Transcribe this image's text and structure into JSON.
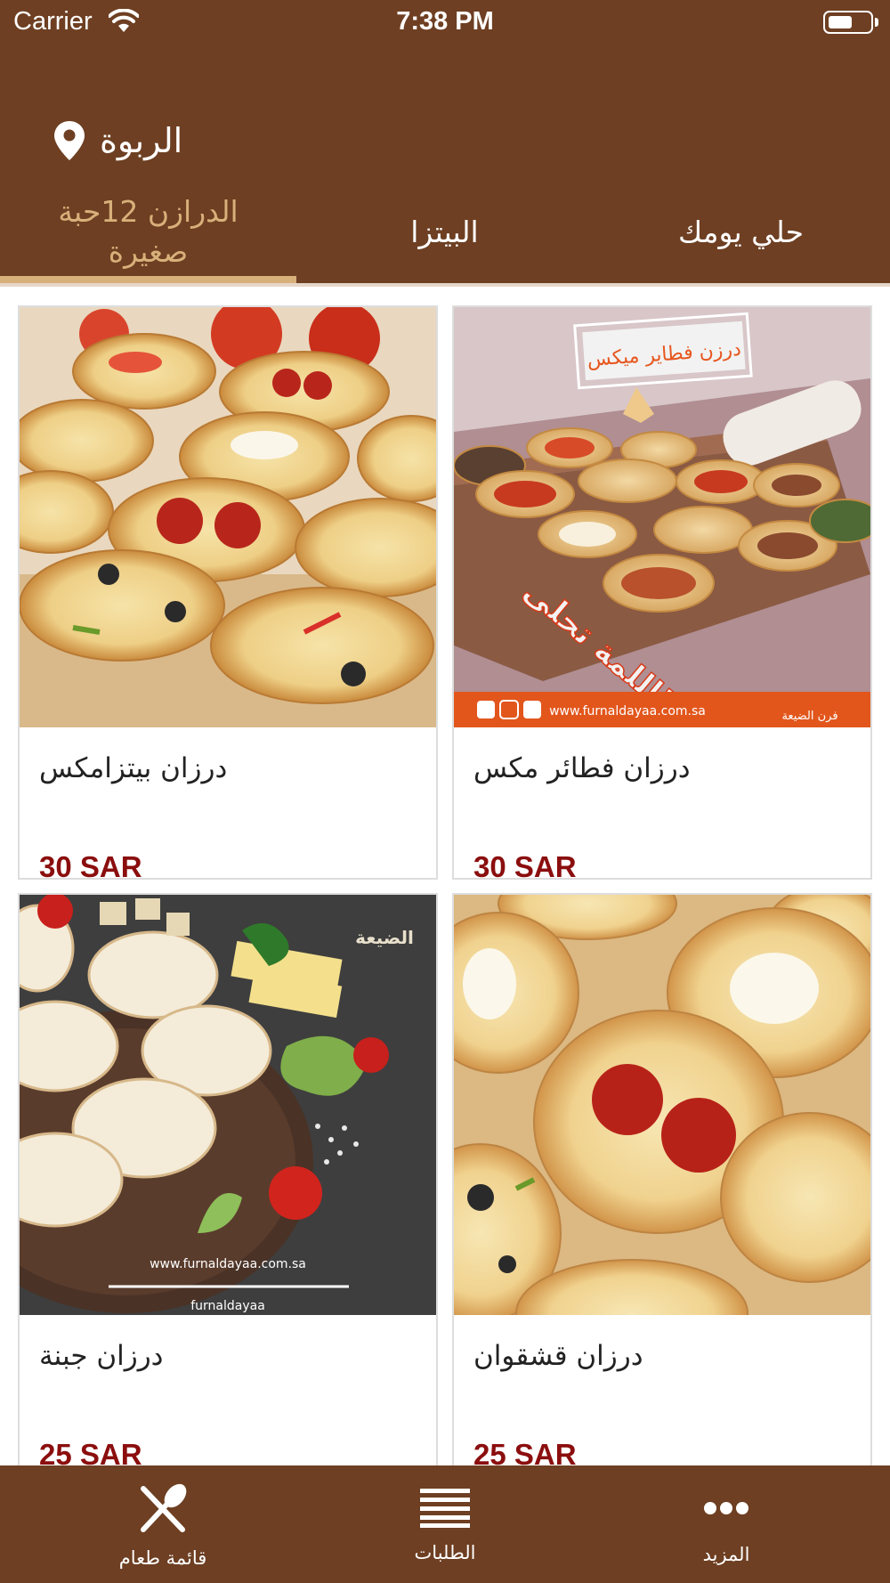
{
  "status_bar": {
    "carrier": "Carrier",
    "time": "7:38 PM",
    "battery_level": 0.6
  },
  "location": {
    "label": "الربوة",
    "icon": "map-pin-icon"
  },
  "category_tabs": [
    {
      "label": "الدرازن 12حبة صغيرة",
      "active": true
    },
    {
      "label": "البيتزا",
      "active": false
    },
    {
      "label": "حلي يومك",
      "active": false
    }
  ],
  "products": [
    {
      "name": "درزان بيتزامكس",
      "price": "30 SAR"
    },
    {
      "name": "درزان فطائر مكس",
      "price": "30 SAR",
      "image_text": {
        "banner": "درزن فطاير ميكس",
        "slogan": "اللمة تحلى!",
        "website": "www.furnaldayaa.com.sa",
        "brand": "فرن الضيعة"
      }
    },
    {
      "name": "درزان جبنة",
      "price": "25 SAR",
      "image_text": {
        "brand": "الضيعة",
        "website": "www.furnaldayaa.com.sa",
        "handle": "furnaldayaa"
      }
    },
    {
      "name": "درزان قشقوان",
      "price": "25 SAR"
    }
  ],
  "bottom_tabs": [
    {
      "label": "قائمة طعام",
      "icon": "fork-knife-icon"
    },
    {
      "label": "الطلبات",
      "icon": "list-icon"
    },
    {
      "label": "المزيد",
      "icon": "more-dots-icon"
    }
  ],
  "colors": {
    "brand_brown": "#6e3f22",
    "accent_gold": "#d8b07a",
    "price_red": "#8b0e0e"
  }
}
